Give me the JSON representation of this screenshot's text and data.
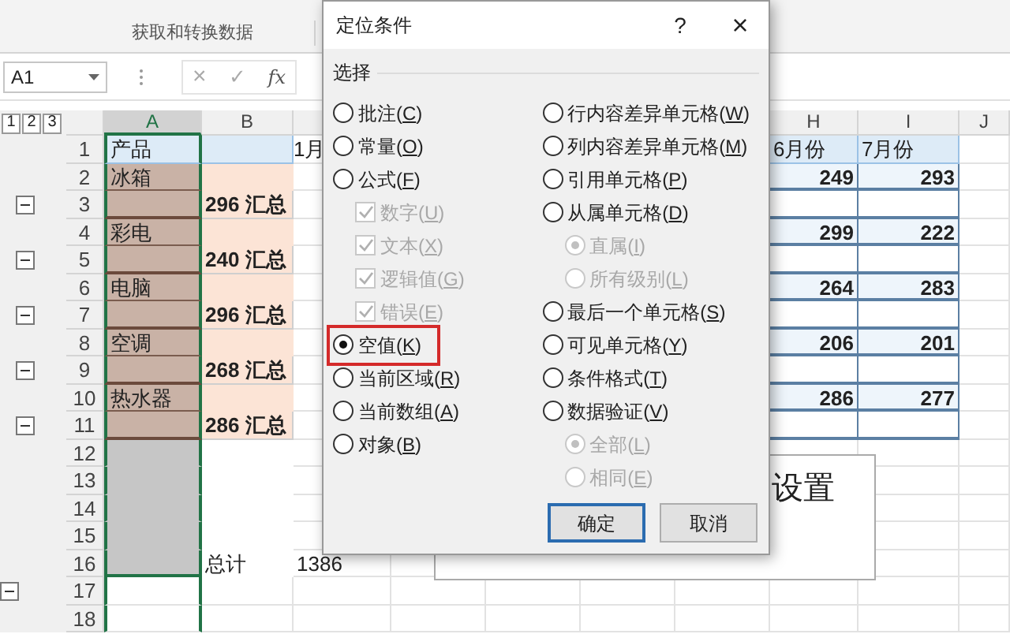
{
  "ribbon": {
    "group_label": "获取和转换数据"
  },
  "formula_bar": {
    "name_box": "A1",
    "cancel": "×",
    "enter": "✓",
    "function": "fx"
  },
  "outline": {
    "levels": [
      "1",
      "2",
      "3"
    ]
  },
  "sheet": {
    "columns": [
      "",
      "A",
      "B",
      "",
      "",
      "",
      "",
      "",
      "H",
      "I",
      "J"
    ],
    "rows": [
      {
        "kind": "header",
        "num": "1",
        "cells": {
          "A": "产品",
          "C": "1月",
          "H": "6月份",
          "I": "7月份"
        }
      },
      {
        "kind": "item",
        "num": "2",
        "cells": {
          "A": "冰箱",
          "H": "249",
          "I": "293"
        }
      },
      {
        "kind": "subtotal",
        "num": "3",
        "outline_button": {
          "kind": "inner",
          "expanded": true
        },
        "cells": {
          "B": "296 汇总"
        }
      },
      {
        "kind": "item",
        "num": "4",
        "cells": {
          "A": "彩电",
          "H": "299",
          "I": "222"
        }
      },
      {
        "kind": "subtotal",
        "num": "5",
        "outline_button": {
          "kind": "inner",
          "expanded": true
        },
        "cells": {
          "B": "240 汇总"
        }
      },
      {
        "kind": "item",
        "num": "6",
        "cells": {
          "A": "电脑",
          "H": "264",
          "I": "283"
        }
      },
      {
        "kind": "subtotal",
        "num": "7",
        "outline_button": {
          "kind": "inner",
          "expanded": true
        },
        "cells": {
          "B": "296 汇总"
        }
      },
      {
        "kind": "item",
        "num": "8",
        "cells": {
          "A": "空调",
          "H": "206",
          "I": "201"
        }
      },
      {
        "kind": "subtotal",
        "num": "9",
        "outline_button": {
          "kind": "inner",
          "expanded": true
        },
        "cells": {
          "B": "268 汇总"
        }
      },
      {
        "kind": "item",
        "num": "10",
        "cells": {
          "A": "热水器",
          "H": "286",
          "I": "277"
        }
      },
      {
        "kind": "subtotal",
        "num": "11",
        "outline_button": {
          "kind": "inner",
          "expanded": true
        },
        "cells": {
          "B": "286 汇总"
        }
      },
      {
        "kind": "blank",
        "num": "12",
        "cells": {}
      },
      {
        "kind": "blank",
        "num": "13",
        "cells": {}
      },
      {
        "kind": "blank",
        "num": "14",
        "cells": {}
      },
      {
        "kind": "blank",
        "num": "15",
        "cells": {}
      },
      {
        "kind": "blank",
        "num": "16",
        "cells": {
          "B": "总计",
          "C": "1386"
        }
      },
      {
        "kind": "plain",
        "num": "17",
        "outline_button": {
          "kind": "outer",
          "expanded": true
        },
        "cells": {}
      },
      {
        "kind": "plain",
        "num": "18",
        "cells": {}
      }
    ],
    "text_box": {
      "text": "设置"
    }
  },
  "dialog": {
    "title": "定位条件",
    "help": "?",
    "close": "×",
    "group_label": "选择",
    "left_options": [
      {
        "kind": "radio",
        "label": "批注(C)",
        "selected": false,
        "highlighted": false
      },
      {
        "kind": "radio",
        "label": "常量(O)",
        "selected": false,
        "highlighted": false
      },
      {
        "kind": "radio",
        "label": "公式(F)",
        "selected": false,
        "highlighted": false,
        "children": [
          {
            "kind": "checkbox",
            "label": "数字(U)",
            "checked": true,
            "disabled": true
          },
          {
            "kind": "checkbox",
            "label": "文本(X)",
            "checked": true,
            "disabled": true
          },
          {
            "kind": "checkbox",
            "label": "逻辑值(G)",
            "checked": true,
            "disabled": true
          },
          {
            "kind": "checkbox",
            "label": "错误(E)",
            "checked": true,
            "disabled": true
          }
        ]
      },
      {
        "kind": "radio",
        "label": "空值(K)",
        "selected": true,
        "highlighted": true
      },
      {
        "kind": "radio",
        "label": "当前区域(R)",
        "selected": false,
        "highlighted": false
      },
      {
        "kind": "radio",
        "label": "当前数组(A)",
        "selected": false,
        "highlighted": false
      },
      {
        "kind": "radio",
        "label": "对象(B)",
        "selected": false,
        "highlighted": false
      }
    ],
    "right_options": [
      {
        "kind": "radio",
        "label": "行内容差异单元格(W)",
        "selected": false,
        "highlighted": false
      },
      {
        "kind": "radio",
        "label": "列内容差异单元格(M)",
        "selected": false,
        "highlighted": false
      },
      {
        "kind": "radio",
        "label": "引用单元格(P)",
        "selected": false,
        "highlighted": false
      },
      {
        "kind": "radio",
        "label": "从属单元格(D)",
        "selected": false,
        "highlighted": false,
        "children": [
          {
            "kind": "radio",
            "label": "直属(I)",
            "selected": true,
            "disabled": true
          },
          {
            "kind": "radio",
            "label": "所有级别(L)",
            "selected": false,
            "disabled": true
          }
        ]
      },
      {
        "kind": "radio",
        "label": "最后一个单元格(S)",
        "selected": false,
        "highlighted": false
      },
      {
        "kind": "radio",
        "label": "可见单元格(Y)",
        "selected": false,
        "highlighted": false
      },
      {
        "kind": "radio",
        "label": "条件格式(T)",
        "selected": false,
        "highlighted": false
      },
      {
        "kind": "radio",
        "label": "数据验证(V)",
        "selected": false,
        "highlighted": false,
        "children": [
          {
            "kind": "radio",
            "label": "全部(L)",
            "selected": true,
            "disabled": true
          },
          {
            "kind": "radio",
            "label": "相同(E)",
            "selected": false,
            "disabled": true
          }
        ]
      }
    ],
    "buttons": [
      {
        "label": "确定",
        "primary": true
      },
      {
        "label": "取消",
        "primary": false
      }
    ]
  }
}
